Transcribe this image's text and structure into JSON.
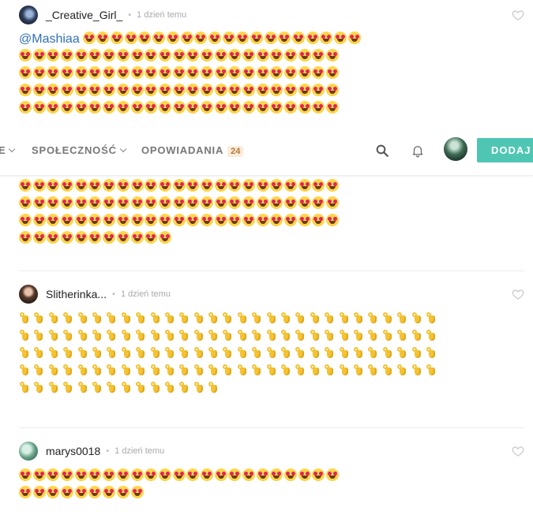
{
  "navbar": {
    "truncated_item": "E",
    "community_label": "SPOŁECZNOŚĆ",
    "stories_label": "OPOWIADANIA",
    "stories_count": "24",
    "add_label": "DODAJ",
    "icons": [
      "search-icon",
      "bell-icon",
      "user-avatar",
      "chevron-down-icon"
    ]
  },
  "comments": [
    {
      "username": "_Creative_Girl_",
      "time": "1 dzień temu",
      "mention": "@Mashiaa",
      "emoji": "heart-eyes",
      "rows_top": [
        20,
        23,
        23,
        23,
        23
      ],
      "rows_bottom": [
        23,
        23,
        23,
        11
      ]
    },
    {
      "username": "Slitherinka...",
      "time": "1 dzień temu",
      "emoji": "ok-hand",
      "rows": [
        29,
        29,
        29,
        29,
        14
      ]
    },
    {
      "username": "marys0018",
      "time": "1 dzień temu",
      "emoji": "heart-eyes",
      "rows": [
        23,
        9
      ]
    }
  ],
  "colors": {
    "accent": "#4fc6b3",
    "mention": "#2f6fb8",
    "badge_bg": "#fcebd8"
  }
}
